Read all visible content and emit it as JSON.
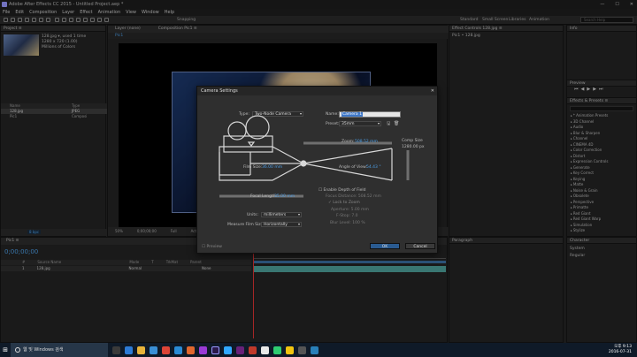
{
  "titlebar": {
    "title": "Adobe After Effects CC 2015 - Untitled Project.aep *",
    "controls": [
      "—",
      "☐",
      "✕"
    ]
  },
  "menu": [
    "File",
    "Edit",
    "Composition",
    "Layer",
    "Effect",
    "Animation",
    "View",
    "Window",
    "Help"
  ],
  "toolbar": {
    "snapping": "Snapping",
    "workspaces": [
      "Standard",
      "Small Screen",
      "Libraries",
      "Animation"
    ],
    "search_placeholder": "Search Help"
  },
  "project": {
    "tab": "Project ≡",
    "item_name": "128.jpg ▾, used 1 time",
    "dimensions": "1280 x 720 (1.00)",
    "colors": "Millions of Colors",
    "columns": [
      "Name",
      "Type"
    ],
    "rows": [
      {
        "name": "128.jpg",
        "type": "JPEG"
      },
      {
        "name": "Pic1",
        "type": "Composi"
      }
    ],
    "bpc": "8 bpc"
  },
  "comp": {
    "tabs": [
      "Layer (none)",
      "Composition Pic1 ≡"
    ],
    "sub": "Pic1",
    "footer": [
      "50%",
      "0;00;00;00",
      "Full",
      "Active Camera",
      "1 View"
    ]
  },
  "effects_controls": {
    "tab": "Effect Controls 128.jpg ≡",
    "sub": "Pic1 • 128.jpg"
  },
  "info": {
    "tab": "Info"
  },
  "preview": {
    "tab": "Preview"
  },
  "effects_presets": {
    "tab": "Effects & Presets ≡",
    "items": [
      "* Animation Presets",
      "3D Channel",
      "Audio",
      "Blur & Sharpen",
      "Channel",
      "CINEMA 4D",
      "Color Correction",
      "Distort",
      "Expression Controls",
      "Generate",
      "Key Correct",
      "Keying",
      "Matte",
      "Noise & Grain",
      "Obsolete",
      "Perspective",
      "Primatte",
      "Red Giant",
      "Red Giant Warp",
      "Simulation",
      "Stylize"
    ]
  },
  "timeline": {
    "tab": "Pic1 ≡",
    "timecode": "0;00;00;00",
    "columns": [
      "#",
      "Source Name",
      "Mode",
      "T",
      "TrkMat",
      "Parent"
    ],
    "layer": {
      "num": "1",
      "name": "128.jpg",
      "mode": "Normal",
      "parent": "None"
    }
  },
  "character": {
    "tab": "Character",
    "font": "System",
    "style": "Regular",
    "paragraph": "Paragraph"
  },
  "dialog": {
    "title": "Camera Settings",
    "close": "✕",
    "type_label": "Type:",
    "type_value": "Two-Node Camera",
    "name_label": "Name:",
    "name_value": "Camera 1",
    "preset_label": "Preset:",
    "preset_value": "35mm",
    "zoom_label": "Zoom:",
    "zoom_value": "508.52 mm",
    "film_size_label": "Film Size:",
    "film_size_value": "36.00 mm",
    "angle_label": "Angle of View:",
    "angle_value": "54.43 °",
    "comp_size_label": "Comp Size",
    "comp_size_value": "1280.00 px",
    "focal_length_label": "Focal Length:",
    "focal_length_value": "35.00 mm",
    "enable_dof": "Enable Depth of Field",
    "focus_distance": "Focus Distance: 508.52 mm",
    "lock_to_zoom": "Lock to Zoom",
    "aperture": "Aperture: 5.00 mm",
    "fstop": "F-Stop: 7.0",
    "blur_level": "Blur Level: 100 %",
    "units_label": "Units:",
    "units_value": "millimeters",
    "measure_label": "Measure Film Size:",
    "measure_value": "Horizontally",
    "preview": "Preview",
    "ok": "OK",
    "cancel": "Cancel"
  },
  "taskbar": {
    "search": "웹 및 Windows 검색",
    "time": "오후 9:13",
    "date": "2016-07-31"
  }
}
